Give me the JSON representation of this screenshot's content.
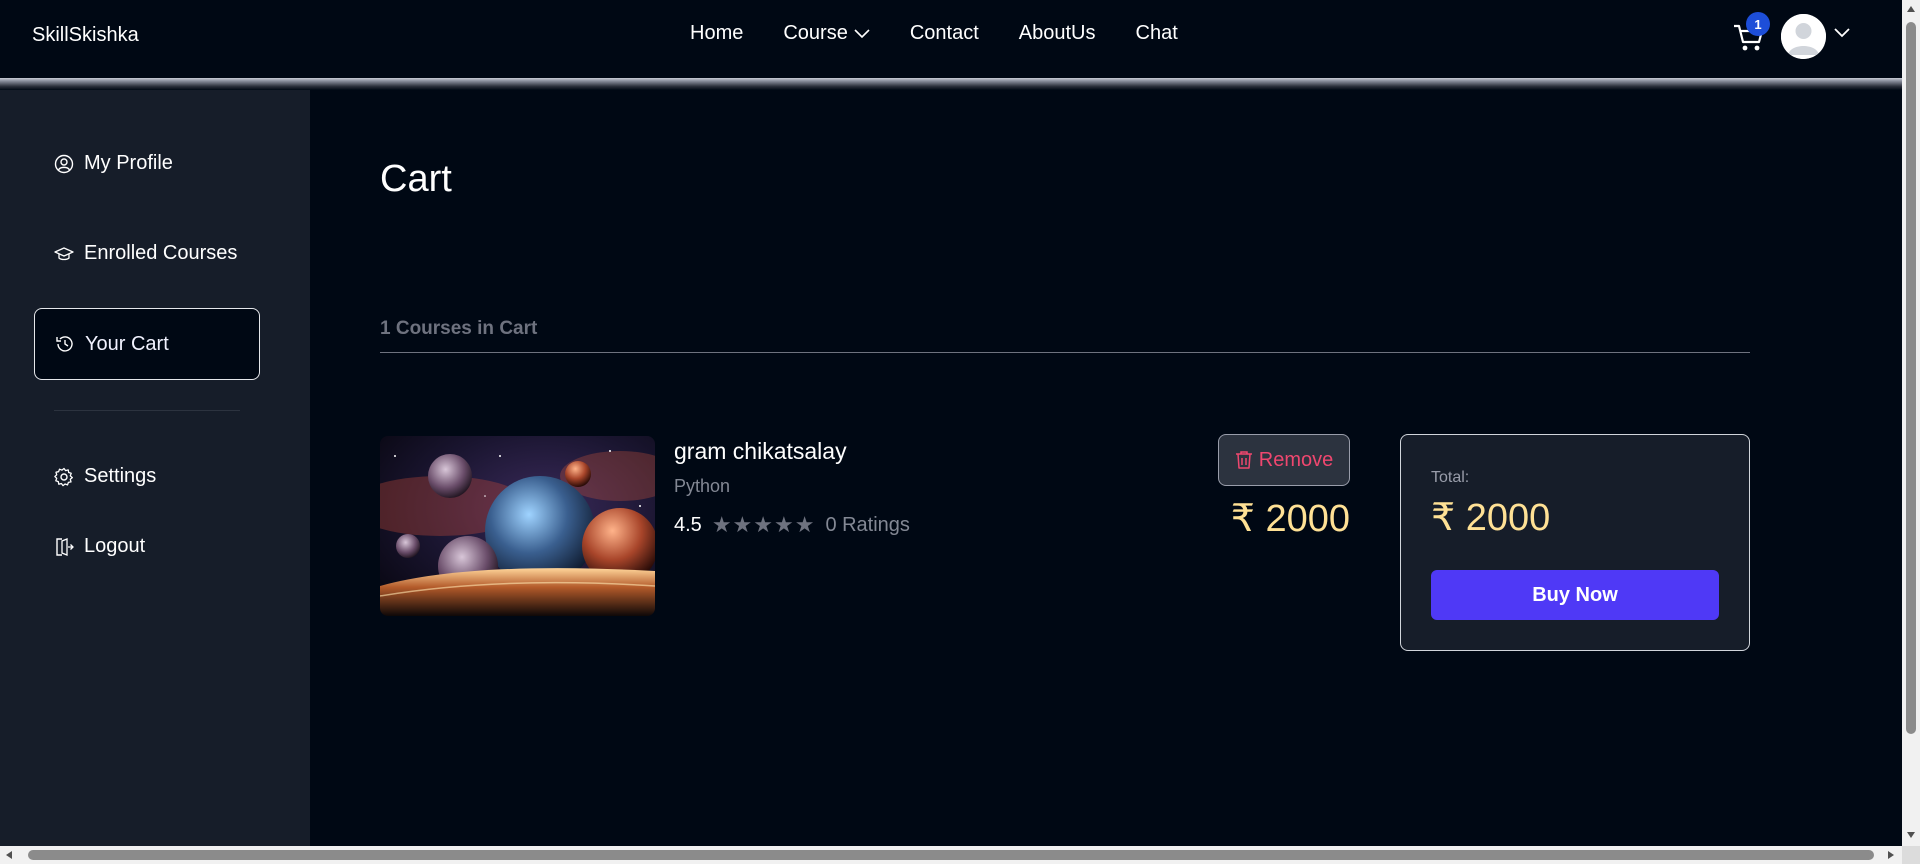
{
  "brand": "SkillSkishka",
  "nav": {
    "items": [
      "Home",
      "Course",
      "Contact",
      "AboutUs",
      "Chat"
    ]
  },
  "cart": {
    "badge_count": "1",
    "icon": "cart-icon"
  },
  "user": {
    "avatar_icon": "user-avatar-icon",
    "menu_icon": "chevron-down-icon"
  },
  "sidebar": {
    "items": [
      {
        "label": "My Profile",
        "icon": "user-circle-icon"
      },
      {
        "label": "Enrolled Courses",
        "icon": "graduation-cap-icon"
      },
      {
        "label": "Your Cart",
        "icon": "history-icon",
        "active": true
      },
      {
        "label": "Settings",
        "icon": "gear-icon"
      },
      {
        "label": "Logout",
        "icon": "logout-icon"
      }
    ]
  },
  "main": {
    "title": "Cart",
    "count_text": "1 Courses in Cart",
    "course": {
      "title": "gram chikatsalay",
      "category": "Python",
      "rating": "4.5",
      "stars": "★★★★★",
      "ratings_text": "0 Ratings",
      "remove_label": "Remove",
      "price": "₹ 2000"
    },
    "summary": {
      "total_label": "Total:",
      "total_price": "₹ 2000",
      "buy_label": "Buy Now"
    }
  },
  "colors": {
    "background": "#000814",
    "sidebar": "#161d29",
    "price": "#ffe195",
    "remove": "#ef476f",
    "buy_button": "#4f39f6",
    "badge": "#1d4ed8"
  }
}
